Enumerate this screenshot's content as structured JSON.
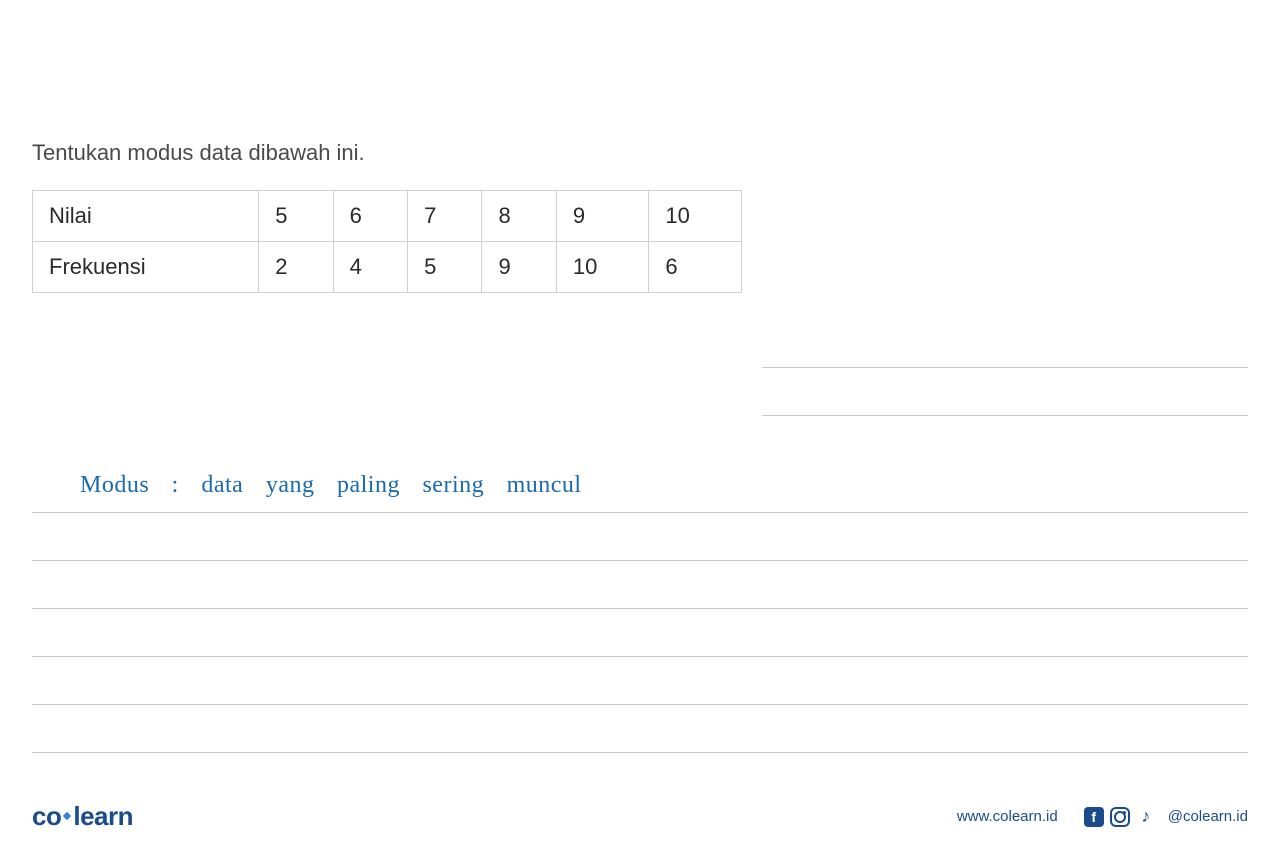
{
  "question": {
    "title": "Tentukan modus data dibawah ini."
  },
  "table": {
    "row1": {
      "label": "Nilai",
      "c1": "5",
      "c2": "6",
      "c3": "7",
      "c4": "8",
      "c5": "9",
      "c6": "10"
    },
    "row2": {
      "label": "Frekuensi",
      "c1": "2",
      "c2": "4",
      "c3": "5",
      "c4": "9",
      "c5": "10",
      "c6": "6"
    }
  },
  "handwriting": {
    "text": "Modus :   data  yang   paling sering   muncul"
  },
  "footer": {
    "logo_part1": "co",
    "logo_part2": "learn",
    "website": "www.colearn.id",
    "handle": "@colearn.id",
    "fb_glyph": "f",
    "tt_glyph": "♪"
  },
  "colors": {
    "brand": "#1a4b8c",
    "accent": "#3b82d4",
    "handwriting": "#1a6bb0",
    "text": "#4a4a4a",
    "border": "#d0d0d0",
    "rule": "#c8c8c8"
  }
}
